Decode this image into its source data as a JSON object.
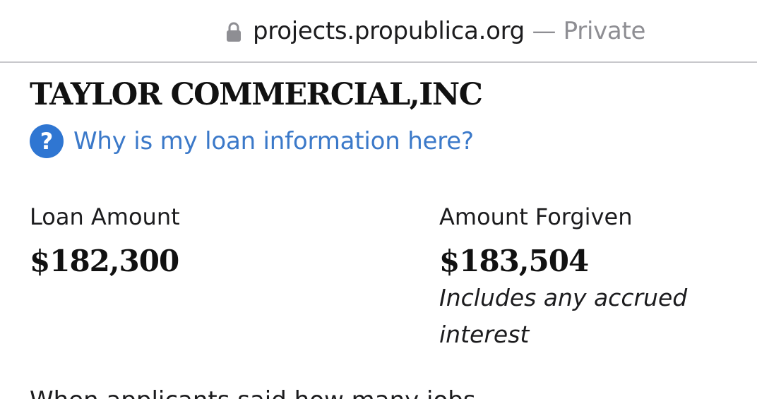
{
  "address_bar": {
    "domain": "projects.propublica.org",
    "separator": " — ",
    "mode": "Private",
    "lock_icon": "lock-icon"
  },
  "business": {
    "name": "TAYLOR COMMERCIAL,INC"
  },
  "help": {
    "icon": "question-mark-icon",
    "icon_glyph": "?",
    "link_text": "Why is my loan information here?",
    "link_color": "#3b79c9",
    "icon_color": "#2f76d2"
  },
  "loan": {
    "label": "Loan Amount",
    "value": "$182,300"
  },
  "forgiven": {
    "label": "Amount Forgiven",
    "value": "$183,504",
    "note": "Includes any accrued interest"
  },
  "truncated_text": "When applicants said how many jobs"
}
